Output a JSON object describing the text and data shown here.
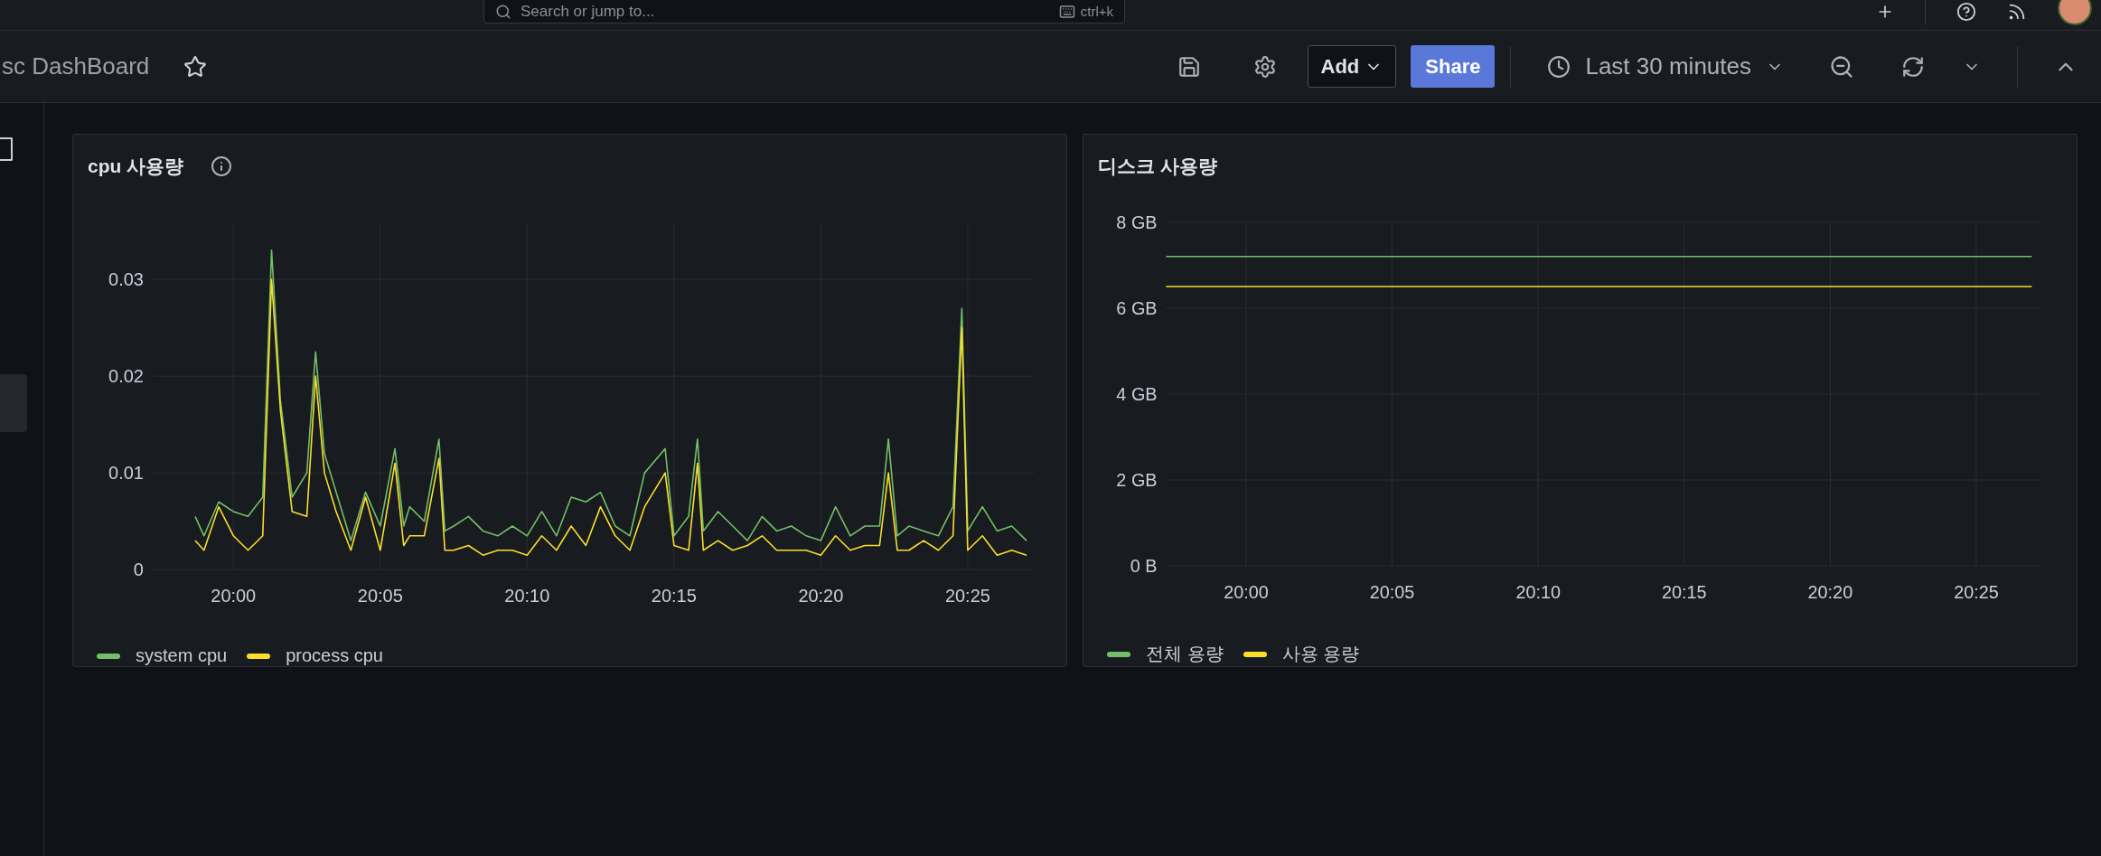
{
  "top_bar": {
    "search": {
      "placeholder": "Search or jump to..."
    },
    "shortcut": "ctrl+k"
  },
  "sidebar": {
    "items": [
      {
        "selected": false
      },
      {
        "selected": true
      }
    ]
  },
  "toolbar": {
    "breadcrumb": "sc DashBoard",
    "starred": false,
    "add_button": "Add",
    "share_button": "Share",
    "time_range": "Last 30 minutes"
  },
  "panels": [
    {
      "title": "cpu 사용량",
      "info": true,
      "chart_data": {
        "type": "line",
        "x": [
          1198.7,
          1199.0,
          1199.5,
          1200,
          1200.5,
          1201.0,
          1201.3,
          1201.6,
          1202.0,
          1202.5,
          1202.8,
          1203.1,
          1203.5,
          1204.0,
          1204.5,
          1205.0,
          1205.5,
          1205.8,
          1206.0,
          1206.5,
          1207.0,
          1207.2,
          1207.5,
          1208.0,
          1208.5,
          1209.0,
          1209.5,
          1210.0,
          1210.5,
          1211.0,
          1211.5,
          1212.0,
          1212.5,
          1213.0,
          1213.5,
          1214.0,
          1214.7,
          1215.0,
          1215.5,
          1215.8,
          1216.0,
          1216.5,
          1217.0,
          1217.5,
          1218.0,
          1218.5,
          1219.0,
          1219.5,
          1220.0,
          1220.5,
          1221.0,
          1221.5,
          1222.0,
          1222.3,
          1222.6,
          1223.0,
          1223.5,
          1224.0,
          1224.5,
          1224.8,
          1225.0,
          1225.5,
          1226.0,
          1226.5,
          1227.0
        ],
        "series": [
          {
            "name": "system cpu",
            "color": "#73bf69",
            "values": [
              0.0055,
              0.0035,
              0.007,
              0.006,
              0.0055,
              0.0075,
              0.033,
              0.0175,
              0.0075,
              0.01,
              0.0225,
              0.012,
              0.008,
              0.003,
              0.008,
              0.0045,
              0.0125,
              0.0045,
              0.0065,
              0.005,
              0.0135,
              0.004,
              0.0045,
              0.0055,
              0.004,
              0.0035,
              0.0045,
              0.0035,
              0.006,
              0.0035,
              0.0075,
              0.007,
              0.008,
              0.0045,
              0.0035,
              0.01,
              0.0125,
              0.0035,
              0.0055,
              0.0135,
              0.004,
              0.006,
              0.0045,
              0.003,
              0.0055,
              0.004,
              0.0045,
              0.0035,
              0.003,
              0.0065,
              0.0035,
              0.0045,
              0.0045,
              0.0135,
              0.0035,
              0.0045,
              0.004,
              0.0035,
              0.0065,
              0.027,
              0.004,
              0.0065,
              0.004,
              0.0045,
              0.003
            ]
          },
          {
            "name": "process cpu",
            "color": "#fade2a",
            "values": [
              0.003,
              0.002,
              0.0065,
              0.0035,
              0.002,
              0.0035,
              0.03,
              0.0165,
              0.006,
              0.0055,
              0.02,
              0.01,
              0.006,
              0.002,
              0.0075,
              0.002,
              0.011,
              0.0025,
              0.0035,
              0.0035,
              0.0115,
              0.002,
              0.002,
              0.0025,
              0.0015,
              0.002,
              0.002,
              0.0015,
              0.0035,
              0.002,
              0.0045,
              0.0025,
              0.0065,
              0.0035,
              0.002,
              0.0065,
              0.01,
              0.0025,
              0.002,
              0.011,
              0.002,
              0.003,
              0.002,
              0.0025,
              0.0035,
              0.002,
              0.002,
              0.002,
              0.0015,
              0.0035,
              0.002,
              0.0025,
              0.0025,
              0.01,
              0.002,
              0.002,
              0.003,
              0.002,
              0.0035,
              0.025,
              0.002,
              0.0035,
              0.0015,
              0.002,
              0.0015
            ]
          }
        ],
        "grid": true,
        "xlim": [
          1197.25,
          1227.25
        ],
        "ylim": [
          0,
          0.0358
        ],
        "xticks": [
          {
            "value": 1200,
            "label": "20:00"
          },
          {
            "value": 1205,
            "label": "20:05"
          },
          {
            "value": 1210,
            "label": "20:10"
          },
          {
            "value": 1215,
            "label": "20:15"
          },
          {
            "value": 1220,
            "label": "20:20"
          },
          {
            "value": 1225,
            "label": "20:25"
          }
        ],
        "yticks": [
          {
            "value": 0,
            "label": "0"
          },
          {
            "value": 0.01,
            "label": "0.01"
          },
          {
            "value": 0.02,
            "label": "0.02"
          },
          {
            "value": 0.03,
            "label": "0.03"
          }
        ]
      }
    },
    {
      "title": "디스크 사용량",
      "chart_data": {
        "type": "line",
        "x": [
          1197.26,
          1226.9
        ],
        "series": [
          {
            "name": "전체 용량",
            "color": "#73bf69",
            "values": [
              7.2,
              7.2
            ]
          },
          {
            "name": "사용 용량",
            "color": "#fade2a",
            "values": [
              6.5,
              6.5
            ]
          }
        ],
        "grid": true,
        "xlim": [
          1197.26,
          1227.2
        ],
        "ylim": [
          0,
          8
        ],
        "xticks": [
          {
            "value": 1200,
            "label": "20:00"
          },
          {
            "value": 1205,
            "label": "20:05"
          },
          {
            "value": 1210,
            "label": "20:10"
          },
          {
            "value": 1215,
            "label": "20:15"
          },
          {
            "value": 1220,
            "label": "20:20"
          },
          {
            "value": 1225,
            "label": "20:25"
          }
        ],
        "yticks": [
          {
            "value": 0,
            "label": "0 B"
          },
          {
            "value": 2,
            "label": "2 GB"
          },
          {
            "value": 4,
            "label": "4 GB"
          },
          {
            "value": 6,
            "label": "6 GB"
          },
          {
            "value": 8,
            "label": "8 GB"
          }
        ]
      }
    }
  ]
}
